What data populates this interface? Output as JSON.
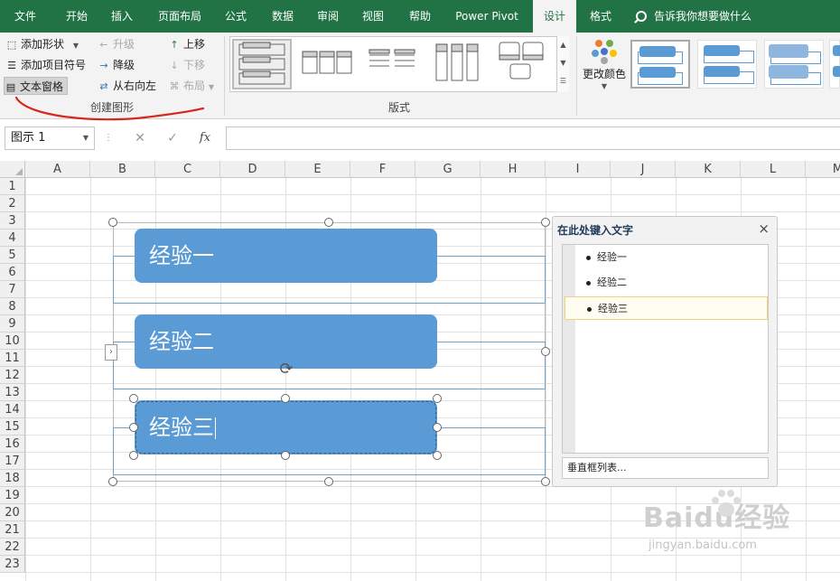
{
  "tabs": [
    {
      "label": "文件"
    },
    {
      "label": "开始"
    },
    {
      "label": "插入"
    },
    {
      "label": "页面布局"
    },
    {
      "label": "公式"
    },
    {
      "label": "数据"
    },
    {
      "label": "审阅"
    },
    {
      "label": "视图"
    },
    {
      "label": "帮助"
    },
    {
      "label": "Power Pivot"
    },
    {
      "label": "设计"
    },
    {
      "label": "格式"
    }
  ],
  "tell_me": "告诉我你想要做什么",
  "ribbon": {
    "create_graphic": {
      "add_shape": "添加形状",
      "add_bullet": "添加项目符号",
      "text_pane": "文本窗格",
      "promote": "升级",
      "demote": "降级",
      "right_to_left": "从右向左",
      "move_up": "上移",
      "move_down": "下移",
      "layout": "布局",
      "group_label": "创建图形"
    },
    "layouts": {
      "group_label": "版式"
    },
    "smartart_styles": {
      "change_colors": "更改颜色"
    }
  },
  "formula_bar": {
    "name_box": "图示 1",
    "cancel_glyph": "✕",
    "enter_glyph": "✓",
    "fx_label": "fx",
    "formula": ""
  },
  "columns": [
    "A",
    "B",
    "C",
    "D",
    "E",
    "F",
    "G",
    "H",
    "I",
    "J",
    "K",
    "L",
    "M"
  ],
  "rows": [
    "1",
    "2",
    "3",
    "4",
    "5",
    "6",
    "7",
    "8",
    "9",
    "10",
    "11",
    "12",
    "13",
    "14",
    "15",
    "16",
    "17",
    "18",
    "19",
    "20",
    "21",
    "22",
    "23"
  ],
  "smartart": {
    "items": [
      "经验一",
      "经验二",
      "经验三"
    ],
    "fill_color": "#5b9bd5"
  },
  "text_pane": {
    "title": "在此处键入文字",
    "close_glyph": "×",
    "items": [
      "经验一",
      "经验二",
      "经验三"
    ],
    "footer": "垂直框列表..."
  },
  "watermark": {
    "main": "Baidu经验",
    "sub": "jingyan.baidu.com"
  },
  "colors": {
    "excel_green": "#217346",
    "accent_blue": "#5b9bd5",
    "annotation_red": "#d9261c"
  }
}
